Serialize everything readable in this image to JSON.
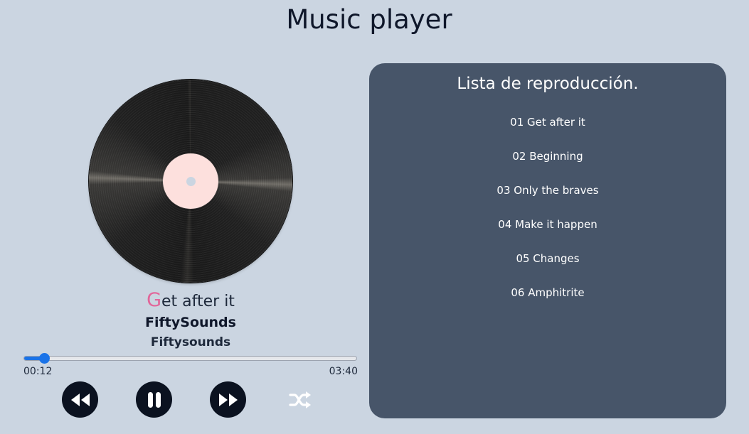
{
  "app": {
    "title": "Music player"
  },
  "now_playing": {
    "title_initial": "G",
    "title_rest": "et after it",
    "artist": "FiftySounds",
    "album": "Fiftysounds"
  },
  "progress": {
    "current": "00:12",
    "total": "03:40",
    "fraction": 0.061
  },
  "controls": {
    "previous": "backward-icon",
    "pause": "pause-icon",
    "next": "forward-icon",
    "shuffle": "shuffle-icon"
  },
  "playlist": {
    "title": "Lista de reproducción.",
    "items": [
      {
        "label": "01 Get after it"
      },
      {
        "label": "02 Beginning"
      },
      {
        "label": "03 Only the braves"
      },
      {
        "label": "04 Make it happen"
      },
      {
        "label": "05 Changes"
      },
      {
        "label": "06 Amphitrite"
      }
    ]
  },
  "colors": {
    "background": "#cbd5e1",
    "playlist_bg": "#475569",
    "accent": "#1a73e8",
    "title_initial": "#e2669a",
    "vinyl_label": "#fde0dd"
  }
}
